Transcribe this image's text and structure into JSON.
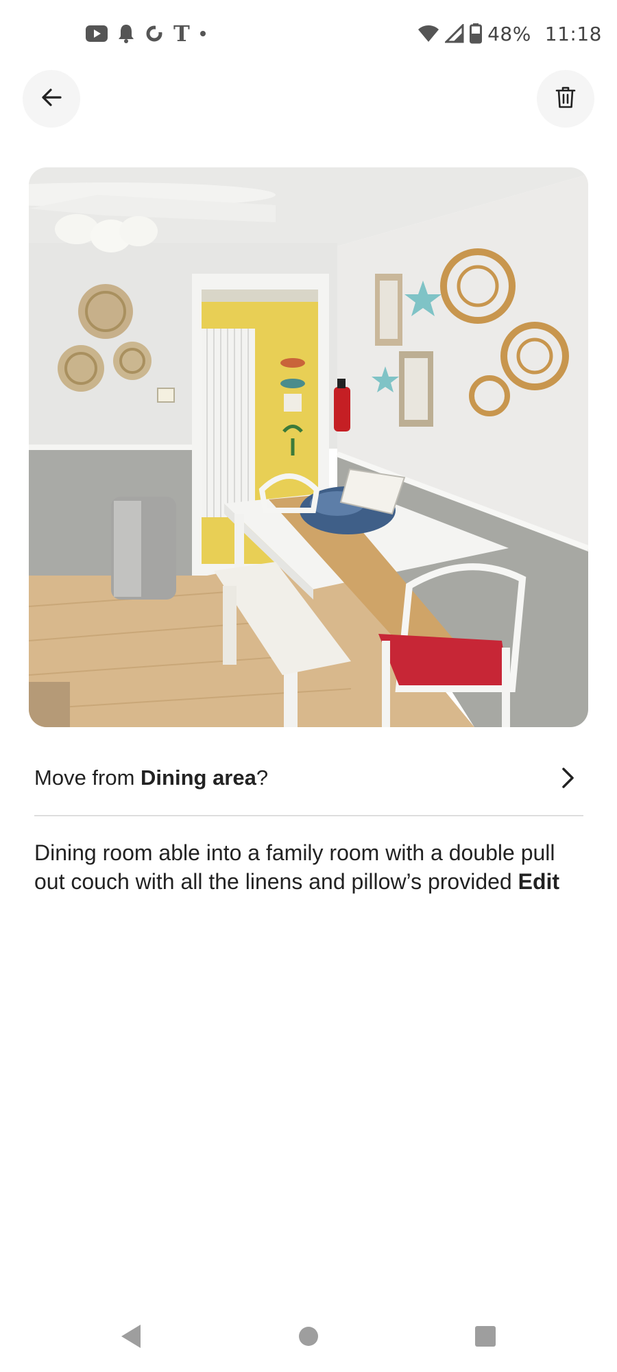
{
  "status_bar": {
    "battery_percent": "48%",
    "time": "11:18",
    "carrier_glyph": "T",
    "left_icons": [
      "youtube-icon",
      "bell-icon",
      "sync-icon",
      "t-mobile-icon",
      "dot-icon"
    ],
    "right_icons": [
      "wifi-icon",
      "signal-icon",
      "battery-icon"
    ]
  },
  "actions": {
    "back_icon": "arrow-left-icon",
    "delete_icon": "trash-icon"
  },
  "photo": {
    "subject": "dining-area-photo"
  },
  "move": {
    "prefix": "Move from ",
    "room": "Dining area",
    "suffix": "?"
  },
  "description": {
    "text": "Dining room able into a family room with a double pull out couch with all the linens and pillow’s provided ",
    "edit_label": "Edit"
  },
  "colors": {
    "text": "#222222",
    "divider": "#dddddd",
    "button_bg": "#f5f5f5",
    "nav_icon": "#9e9e9e"
  }
}
